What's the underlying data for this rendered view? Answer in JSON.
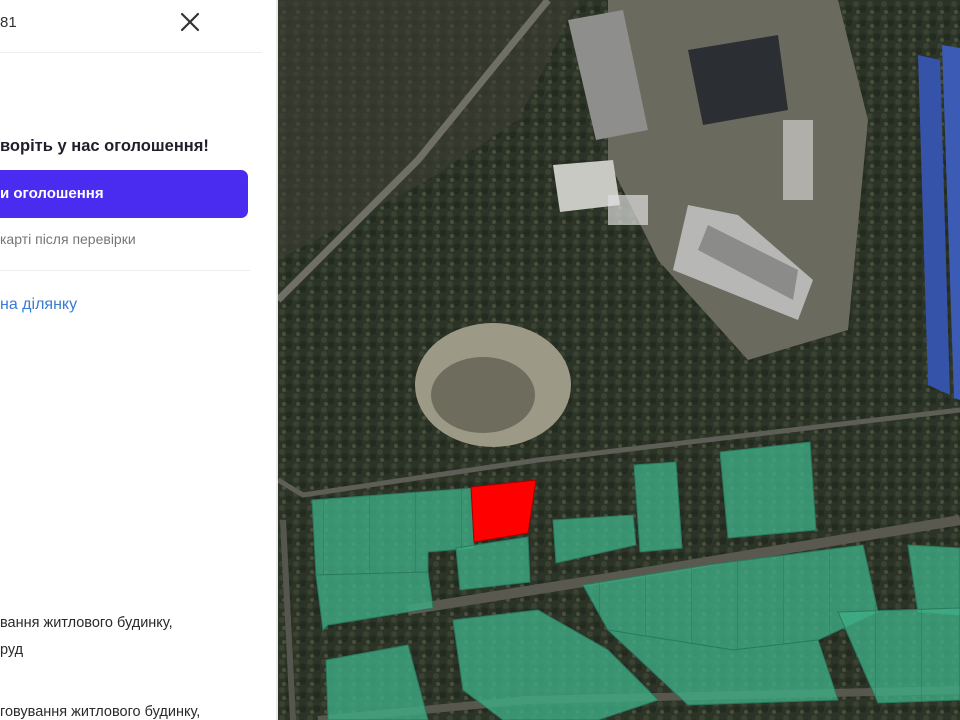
{
  "panel": {
    "header_text": "81",
    "close_icon": "close-icon",
    "promo_title": "ворiть у нас оголошення!",
    "cta_label": "и оголошення",
    "cta_color": "#4a2cf0",
    "cta_note": "карті після перевірки",
    "link_label": "на ділянку",
    "link_color": "#3a7bd5",
    "purpose_lines": [
      "вання житлового будинку,",
      "руд",
      "говування житлового будинку,"
    ]
  },
  "map": {
    "type": "satellite",
    "parcel_color": "#3fae86",
    "selected_parcel_color": "#ff0000"
  }
}
